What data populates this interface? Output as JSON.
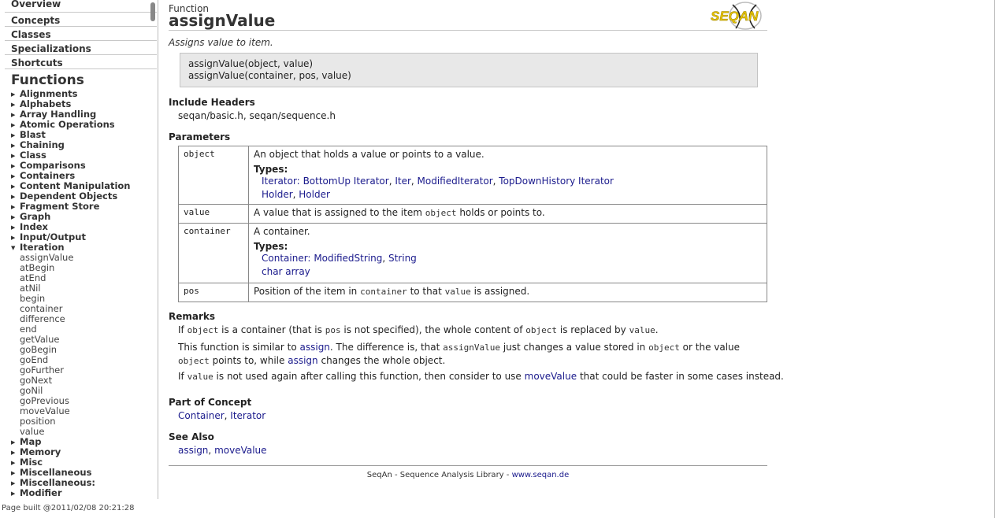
{
  "sidebar": {
    "top_nav": [
      "Overview",
      "Concepts",
      "Classes",
      "Specializations",
      "Shortcuts"
    ],
    "heading": "Functions",
    "groups_before": [
      "Alignments",
      "Alphabets",
      "Array Handling",
      "Atomic Operations",
      "Blast",
      "Chaining",
      "Class",
      "Comparisons",
      "Containers",
      "Content Manipulation",
      "Dependent Objects",
      "Fragment Store",
      "Graph",
      "Index",
      "Input/Output"
    ],
    "expanded_group": "Iteration",
    "expanded_items": [
      "assignValue",
      "atBegin",
      "atEnd",
      "atNil",
      "begin",
      "container",
      "difference",
      "end",
      "getValue",
      "goBegin",
      "goEnd",
      "goFurther",
      "goNext",
      "goNil",
      "goPrevious",
      "moveValue",
      "position",
      "value"
    ],
    "groups_after": [
      "Map",
      "Memory",
      "Misc",
      "Miscellaneous",
      "Miscellaneous:",
      "Modifier"
    ],
    "icons": {
      "collapsed": "triangle-right-icon",
      "expanded": "triangle-down-icon"
    }
  },
  "page_built": "Page built @2011/02/08 20:21:28",
  "main": {
    "kind": "Function",
    "title": "assignValue",
    "logo_text": "SEQAN",
    "summary": "Assigns value to item.",
    "signatures": [
      "assignValue(object, value)",
      "assignValue(container, pos, value)"
    ],
    "include_heading": "Include Headers",
    "include_text": "seqan/basic.h, seqan/sequence.h",
    "params_heading": "Parameters",
    "params": {
      "object": {
        "name": "object",
        "desc": "An object that holds a value or points to a value.",
        "types_label": "Types:",
        "types_line1": {
          "prefix": "Iterator:",
          "links": [
            "BottomUp Iterator",
            "Iter",
            "ModifiedIterator",
            "TopDownHistory Iterator"
          ]
        },
        "types_line2": {
          "links": [
            "Holder",
            "Holder"
          ]
        }
      },
      "value": {
        "name": "value",
        "desc_a": "A value that is assigned to the item",
        "desc_code": "object",
        "desc_b": "holds or points to."
      },
      "container": {
        "name": "container",
        "desc": "A container.",
        "types_label": "Types:",
        "types_line1": {
          "prefix": "Container:",
          "links": [
            "ModifiedString",
            "String"
          ]
        },
        "types_line2": {
          "links": [
            "char array"
          ]
        }
      },
      "pos": {
        "name": "pos",
        "desc_a": "Position of the item in",
        "desc_code1": "container",
        "desc_b": "to that",
        "desc_code2": "value",
        "desc_c": "is assigned."
      }
    },
    "remarks_heading": "Remarks",
    "remark1": {
      "a": "If",
      "c1": "object",
      "b": "is a container (that is",
      "c2": "pos",
      "c": "is not specified), the whole content of",
      "c3": "object",
      "d": "is replaced by",
      "c4": "value",
      "e": "."
    },
    "remark2": {
      "a": "This function is similar to",
      "l1": "assign",
      "b": ". The difference is, that",
      "c1": "assignValue",
      "c": "just changes a value stored in",
      "c2": "object",
      "d": "or the value",
      "c3": "object",
      "e": "points to, while",
      "l2": "assign",
      "f": "changes the whole object."
    },
    "remark3": {
      "a": "If",
      "c1": "value",
      "b": "is not used again after calling this function, then consider to use",
      "l1": "moveValue",
      "c": "that could be faster in some cases instead."
    },
    "concept_heading": "Part of Concept",
    "concepts": [
      "Container",
      "Iterator"
    ],
    "seealso_heading": "See Also",
    "seealso": [
      "assign",
      "moveValue"
    ],
    "footer_text": "SeqAn - Sequence Analysis Library -",
    "footer_link": "www.seqan.de"
  }
}
